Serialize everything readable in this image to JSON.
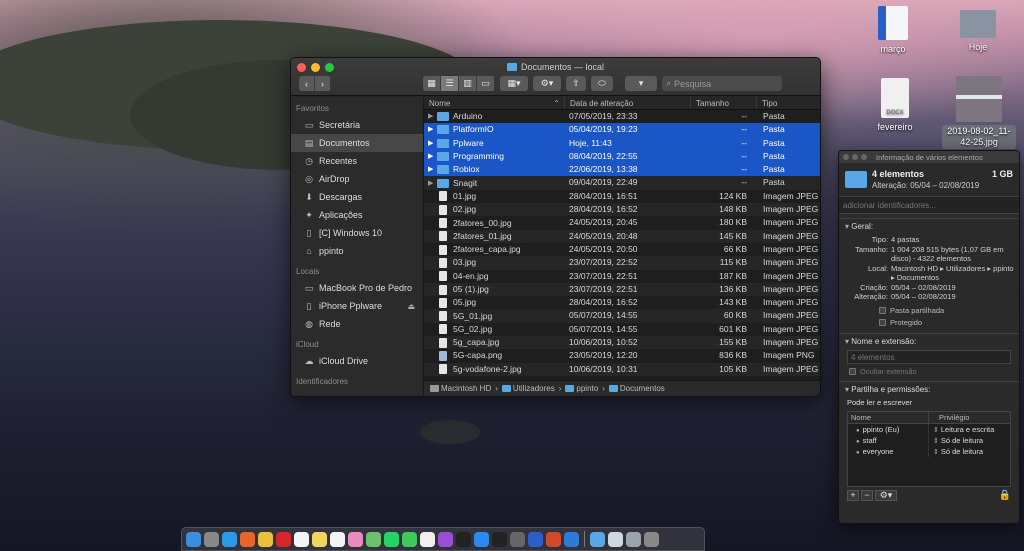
{
  "desktop": {
    "icons": [
      {
        "label": "março",
        "kind": "word"
      },
      {
        "label": "Hoje",
        "kind": "folder"
      },
      {
        "label": "fevereiro",
        "kind": "docx"
      },
      {
        "label": "2019-08-02_11-42-25.jpg",
        "kind": "image"
      }
    ],
    "docx_badge": "DOCX"
  },
  "finder": {
    "title": "Documentos — local",
    "search_placeholder": "Pesquisa",
    "nav": {
      "back": "‹",
      "forward": "›"
    },
    "sidebar": {
      "favorites_header": "Favoritos",
      "favorites": [
        {
          "label": "Secretária",
          "icon": "desktop-icon"
        },
        {
          "label": "Documentos",
          "icon": "documents-icon",
          "selected": true
        },
        {
          "label": "Recentes",
          "icon": "clock-icon"
        },
        {
          "label": "AirDrop",
          "icon": "airdrop-icon"
        },
        {
          "label": "Descargas",
          "icon": "download-icon"
        },
        {
          "label": "Aplicações",
          "icon": "applications-icon"
        },
        {
          "label": "[C] Windows 10",
          "icon": "document-icon"
        },
        {
          "label": "ppinto",
          "icon": "home-icon"
        }
      ],
      "locations_header": "Locais",
      "locations": [
        {
          "label": "MacBook Pro de Pedro",
          "icon": "laptop-icon"
        },
        {
          "label": "iPhone Pplware",
          "icon": "phone-icon",
          "eject": true
        },
        {
          "label": "Rede",
          "icon": "network-icon"
        }
      ],
      "icloud_header": "iCloud",
      "icloud": [
        {
          "label": "iCloud Drive",
          "icon": "cloud-icon"
        }
      ],
      "tags_header": "Identificadores"
    },
    "columns": {
      "name": "Nome",
      "date": "Data de alteração",
      "size": "Tamanho",
      "kind": "Tipo"
    },
    "files": [
      {
        "name": "Arduino",
        "date": "07/05/2019, 23:33",
        "size": "--",
        "kind": "Pasta",
        "type": "folder",
        "selected": false
      },
      {
        "name": "PlatformIO",
        "date": "05/04/2019, 19:23",
        "size": "--",
        "kind": "Pasta",
        "type": "folder",
        "selected": true
      },
      {
        "name": "Pplware",
        "date": "Hoje, 11:43",
        "size": "--",
        "kind": "Pasta",
        "type": "folder",
        "selected": true
      },
      {
        "name": "Programming",
        "date": "08/04/2019, 22:55",
        "size": "--",
        "kind": "Pasta",
        "type": "folder",
        "selected": true
      },
      {
        "name": "Roblox",
        "date": "22/06/2019, 13:38",
        "size": "--",
        "kind": "Pasta",
        "type": "folder",
        "selected": true
      },
      {
        "name": "Snagit",
        "date": "09/04/2019, 22:49",
        "size": "--",
        "kind": "Pasta",
        "type": "folder",
        "selected": false
      },
      {
        "name": "01.jpg",
        "date": "28/04/2019, 16:51",
        "size": "124 KB",
        "kind": "Imagem JPEG",
        "type": "doc",
        "selected": false
      },
      {
        "name": "02.jpg",
        "date": "28/04/2019, 16:52",
        "size": "148 KB",
        "kind": "Imagem JPEG",
        "type": "doc",
        "selected": false
      },
      {
        "name": "2fatores_00.jpg",
        "date": "24/05/2019, 20:45",
        "size": "180 KB",
        "kind": "Imagem JPEG",
        "type": "doc",
        "selected": false
      },
      {
        "name": "2fatores_01.jpg",
        "date": "24/05/2019, 20:48",
        "size": "145 KB",
        "kind": "Imagem JPEG",
        "type": "doc",
        "selected": false
      },
      {
        "name": "2fatores_capa.jpg",
        "date": "24/05/2019, 20:50",
        "size": "66 KB",
        "kind": "Imagem JPEG",
        "type": "doc",
        "selected": false
      },
      {
        "name": "03.jpg",
        "date": "23/07/2019, 22:52",
        "size": "115 KB",
        "kind": "Imagem JPEG",
        "type": "doc",
        "selected": false
      },
      {
        "name": "04-en.jpg",
        "date": "23/07/2019, 22:51",
        "size": "187 KB",
        "kind": "Imagem JPEG",
        "type": "doc",
        "selected": false
      },
      {
        "name": "05 (1).jpg",
        "date": "23/07/2019, 22:51",
        "size": "136 KB",
        "kind": "Imagem JPEG",
        "type": "doc",
        "selected": false
      },
      {
        "name": "05.jpg",
        "date": "28/04/2019, 16:52",
        "size": "143 KB",
        "kind": "Imagem JPEG",
        "type": "doc",
        "selected": false
      },
      {
        "name": "5G_01.jpg",
        "date": "05/07/2019, 14:55",
        "size": "60 KB",
        "kind": "Imagem JPEG",
        "type": "doc",
        "selected": false
      },
      {
        "name": "5G_02.jpg",
        "date": "05/07/2019, 14:55",
        "size": "601 KB",
        "kind": "Imagem JPEG",
        "type": "doc",
        "selected": false
      },
      {
        "name": "5g_capa.jpg",
        "date": "10/06/2019, 10:52",
        "size": "155 KB",
        "kind": "Imagem JPEG",
        "type": "doc",
        "selected": false
      },
      {
        "name": "5G-capa.png",
        "date": "23/05/2019, 12:20",
        "size": "836 KB",
        "kind": "Imagem PNG",
        "type": "png",
        "selected": false
      },
      {
        "name": "5g-vodafone-2.jpg",
        "date": "10/06/2019, 10:31",
        "size": "105 KB",
        "kind": "Imagem JPEG",
        "type": "doc",
        "selected": false
      }
    ],
    "path": [
      "Macintosh HD",
      "Utilizadores",
      "ppinto",
      "Documentos"
    ]
  },
  "info": {
    "title": "Informação de vários elementos",
    "count": "4 elementos",
    "size": "1 GB",
    "modified": "Alteração: 05/04 – 02/08/2019",
    "tags_placeholder": "adicionar identificadores...",
    "general_header": "Geral:",
    "general": [
      {
        "k": "Tipo:",
        "v": "4 pastas"
      },
      {
        "k": "Tamanho:",
        "v": "1 004 208 515 bytes (1,07 GB em disco) - 4322 elementos"
      },
      {
        "k": "Local:",
        "v": "Macintosh HD ▸ Utilizadores ▸ ppinto ▸ Documentos"
      },
      {
        "k": "Criação:",
        "v": "05/04 – 02/08/2019"
      },
      {
        "k": "Alteração:",
        "v": "05/04 – 02/08/2019"
      }
    ],
    "shared_folder": "Pasta partilhada",
    "protected": "Protegido",
    "name_header": "Nome e extensão:",
    "name_value": "4 elementos",
    "hide_extension": "Ocultar extensão",
    "perm_header": "Partilha e permissões:",
    "perm_note": "Pode ler e escrever",
    "perm_cols": {
      "name": "Nome",
      "priv": "Privilégio"
    },
    "perms": [
      {
        "name": "ppinto (Eu)",
        "priv": "Leitura e escrita"
      },
      {
        "name": "staff",
        "priv": "Só de leitura"
      },
      {
        "name": "everyone",
        "priv": "Só de leitura"
      }
    ],
    "foot": {
      "add": "+",
      "remove": "−",
      "action": "⚙▾",
      "lock": "🔒"
    }
  },
  "dock": {
    "apps": [
      {
        "name": "finder",
        "color": "#3b8fe0"
      },
      {
        "name": "launchpad",
        "color": "#888"
      },
      {
        "name": "safari",
        "color": "#2a9be8"
      },
      {
        "name": "firefox",
        "color": "#e8652a"
      },
      {
        "name": "chrome",
        "color": "#e9c23a"
      },
      {
        "name": "opera",
        "color": "#d8262a"
      },
      {
        "name": "calendar",
        "color": "#f4f4f4"
      },
      {
        "name": "notes",
        "color": "#f0d460"
      },
      {
        "name": "reminders",
        "color": "#f4f4f4"
      },
      {
        "name": "photos",
        "color": "#e98ac0"
      },
      {
        "name": "maps",
        "color": "#6cc26c"
      },
      {
        "name": "whatsapp",
        "color": "#25d366"
      },
      {
        "name": "messages",
        "color": "#3fc95a"
      },
      {
        "name": "music",
        "color": "#f0f0f0"
      },
      {
        "name": "podcasts",
        "color": "#9b4fd6"
      },
      {
        "name": "tv",
        "color": "#222"
      },
      {
        "name": "app-store",
        "color": "#2b8af0"
      },
      {
        "name": "terminal",
        "color": "#222"
      },
      {
        "name": "help",
        "color": "#666"
      },
      {
        "name": "word",
        "color": "#2b5ec6"
      },
      {
        "name": "powerpoint",
        "color": "#d14a2a"
      },
      {
        "name": "snagit",
        "color": "#2e7ad6"
      }
    ],
    "docs": [
      {
        "name": "folder",
        "color": "#5aa7e6"
      },
      {
        "name": "preview",
        "color": "#cfd8e0"
      },
      {
        "name": "screenshot",
        "color": "#9aa4ae"
      },
      {
        "name": "trash",
        "color": "#888"
      }
    ]
  }
}
